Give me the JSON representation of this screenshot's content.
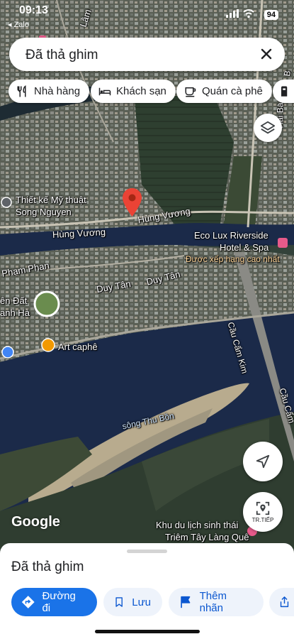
{
  "status_bar": {
    "time": "09:13",
    "back_app": "◂ Zalo",
    "battery": "94"
  },
  "search": {
    "text": "Đã thả ghim"
  },
  "chips": [
    {
      "label": "Nhà hàng",
      "icon": "restaurant-icon"
    },
    {
      "label": "Khách sạn",
      "icon": "hotel-icon"
    },
    {
      "label": "Quán cà phê",
      "icon": "coffee-icon"
    },
    {
      "label": "",
      "icon": "gas-station-icon"
    }
  ],
  "map_labels": {
    "street_top_1": "Lâm",
    "street_top_right_1": "Hai Bà",
    "street_top_right_2": "B",
    "poi_design_1": "Thiết kế Mỹ thuật",
    "poi_design_2": "Song Nguyen",
    "road_hung_vuong_1": "Hùng Vương",
    "road_hung_vuong_2": "Hùng Vương",
    "hotel_1": "Eco Lux Riverside",
    "hotel_2": "Hotel & Spa",
    "hotel_rating": "Được xếp hạng cao nhất",
    "street_pham_phan": "Phạm Phan",
    "street_duy_tan_1": "Duy Tân",
    "street_duy_tan_2": "Duy Tân",
    "poi_left_1": "ên Đất",
    "poi_left_2": "anh Hà",
    "poi_art_caphe": "Art caphê",
    "bridge_1": "Cầu Cẩm Kim",
    "bridge_2": "Cầu Cẩm",
    "river": "sông Thu Bồn",
    "eco_1": "Khu du lịch sinh thái",
    "eco_2": "Triêm Tây Làng Quê"
  },
  "map_buttons": {
    "next_label": "TR.TIẾP"
  },
  "branding": {
    "google": "Google"
  },
  "sheet": {
    "title": "Đã thả ghim",
    "actions": [
      {
        "label": "Đường đi",
        "icon": "directions-icon"
      },
      {
        "label": "Lưu",
        "icon": "bookmark-icon"
      },
      {
        "label": "Thêm nhãn",
        "icon": "flag-icon"
      },
      {
        "label": "",
        "icon": "share-icon"
      }
    ]
  },
  "colors": {
    "accent": "#1a73e8",
    "pin": "#ea4335",
    "river": "#1b2a49"
  }
}
